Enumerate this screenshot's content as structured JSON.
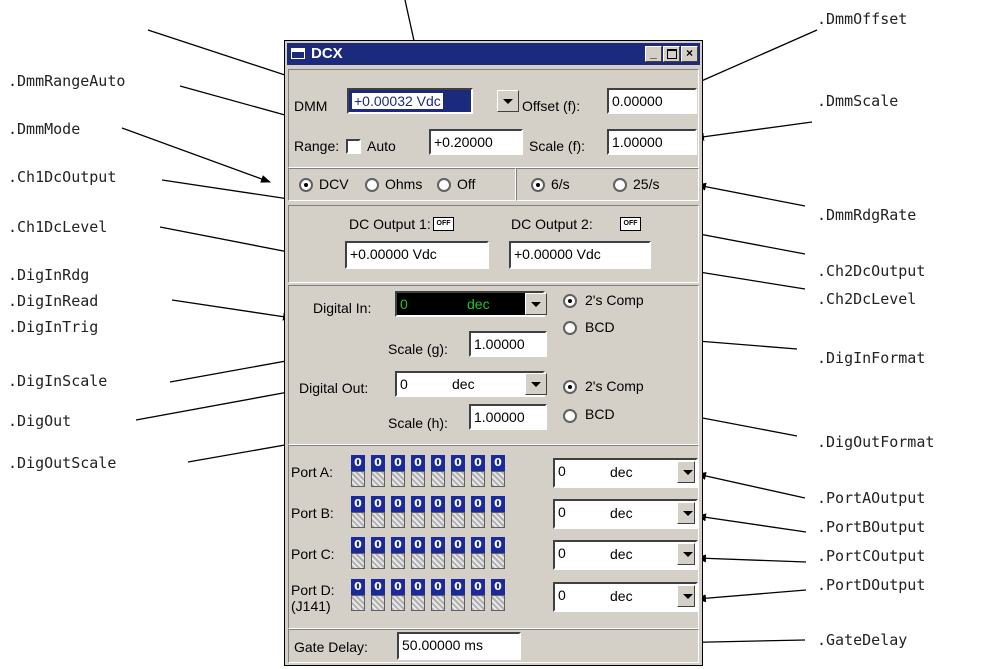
{
  "window": {
    "title": "DCX",
    "dmm": {
      "label": "DMM",
      "reading": "+0.00032 Vdc",
      "offset_label": "Offset (f):",
      "offset_value": "0.00000",
      "range_label": "Range:",
      "auto_label": "Auto",
      "range_value": "+0.20000",
      "auto_checked": false,
      "scale_label": "Scale (f):",
      "scale_value": "1.00000",
      "modes": [
        "DCV",
        "Ohms",
        "Off"
      ],
      "mode_selected": "DCV",
      "rates": [
        "6/s",
        "25/s"
      ],
      "rate_selected": "6/s"
    },
    "dc_output": {
      "ch1_label": "DC Output 1:",
      "ch2_label": "DC Output 2:",
      "ch1_button": "OFF",
      "ch2_button": "OFF",
      "ch1_level": "+0.00000 Vdc",
      "ch2_level": "+0.00000 Vdc"
    },
    "digital": {
      "in_label": "Digital In:",
      "in_value": "0",
      "in_unit": "dec",
      "in_scale_label": "Scale (g):",
      "in_scale_value": "1.00000",
      "in_formats": [
        "2's Comp",
        "BCD"
      ],
      "in_format_selected": "2's Comp",
      "out_label": "Digital Out:",
      "out_value": "0",
      "out_unit": "dec",
      "out_scale_label": "Scale (h):",
      "out_scale_value": "1.00000",
      "out_formats": [
        "2's Comp",
        "BCD"
      ],
      "out_format_selected": "2's Comp"
    },
    "ports": [
      {
        "label": "Port A:",
        "sublabel": "",
        "bits": [
          "0",
          "0",
          "0",
          "0",
          "0",
          "0",
          "0",
          "0"
        ],
        "value": "0",
        "unit": "dec"
      },
      {
        "label": "Port B:",
        "sublabel": "",
        "bits": [
          "0",
          "0",
          "0",
          "0",
          "0",
          "0",
          "0",
          "0"
        ],
        "value": "0",
        "unit": "dec"
      },
      {
        "label": "Port C:",
        "sublabel": "",
        "bits": [
          "0",
          "0",
          "0",
          "0",
          "0",
          "0",
          "0",
          "0"
        ],
        "value": "0",
        "unit": "dec"
      },
      {
        "label": "Port D:",
        "sublabel": "(J141)",
        "bits": [
          "0",
          "0",
          "0",
          "0",
          "0",
          "0",
          "0",
          "0"
        ],
        "value": "0",
        "unit": "dec"
      }
    ],
    "gate_delay": {
      "label": "Gate Delay:",
      "value": "50.00000 ms"
    }
  },
  "callouts": {
    "left": [
      ".DmmRangeAuto",
      ".DmmMode",
      ".Ch1DcOutput",
      ".Ch1DcLevel",
      ".DigInRdg",
      ".DigInRead",
      ".DigInTrig",
      ".DigInScale",
      ".DigOut",
      ".DigOutScale"
    ],
    "right": [
      ".DmmOffset",
      ".DmmScale",
      ".DmmRdgRate",
      ".Ch2DcOutput",
      ".Ch2DcLevel",
      ".DigInFormat",
      ".DigOutFormat",
      ".PortAOutput",
      ".PortBOutput",
      ".PortCOutput",
      ".PortDOutput",
      ".GateDelay"
    ]
  }
}
